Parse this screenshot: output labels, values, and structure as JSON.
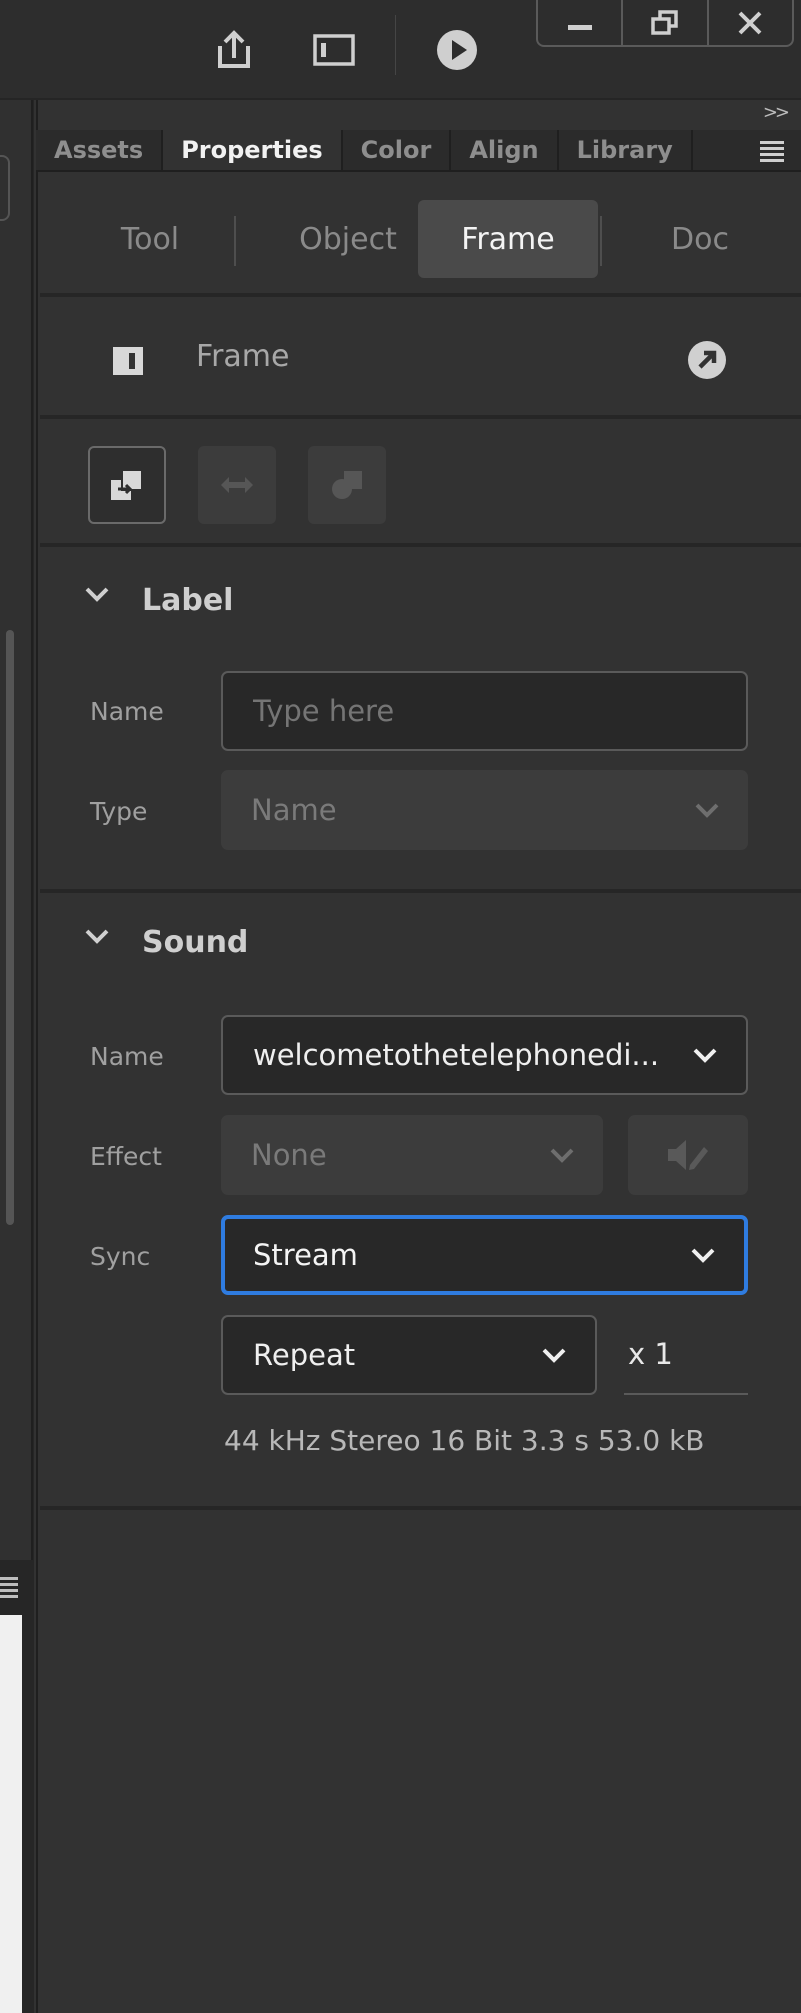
{
  "tabs": [
    {
      "label": "Assets"
    },
    {
      "label": "Properties"
    },
    {
      "label": "Color"
    },
    {
      "label": "Align"
    },
    {
      "label": "Library"
    }
  ],
  "segments": [
    {
      "label": "Tool"
    },
    {
      "label": "Object"
    },
    {
      "label": "Frame"
    },
    {
      "label": "Doc"
    }
  ],
  "header": {
    "collapse_glyph": ">>",
    "title": "Frame"
  },
  "label_section": {
    "title": "Label",
    "name_label": "Name",
    "name_placeholder": "Type here",
    "type_label": "Type",
    "type_value": "Name"
  },
  "sound_section": {
    "title": "Sound",
    "name_label": "Name",
    "name_value": "welcometothetelephonedi...",
    "effect_label": "Effect",
    "effect_value": "None",
    "sync_label": "Sync",
    "sync_value": "Stream",
    "repeat_value": "Repeat",
    "repeat_count": "x 1",
    "info": "44 kHz Stereo 16 Bit 3.3 s 53.0 kB"
  },
  "colors": {
    "focus": "#2f7ce0",
    "panel": "#323232",
    "active_tab": "#f2f2f2"
  }
}
